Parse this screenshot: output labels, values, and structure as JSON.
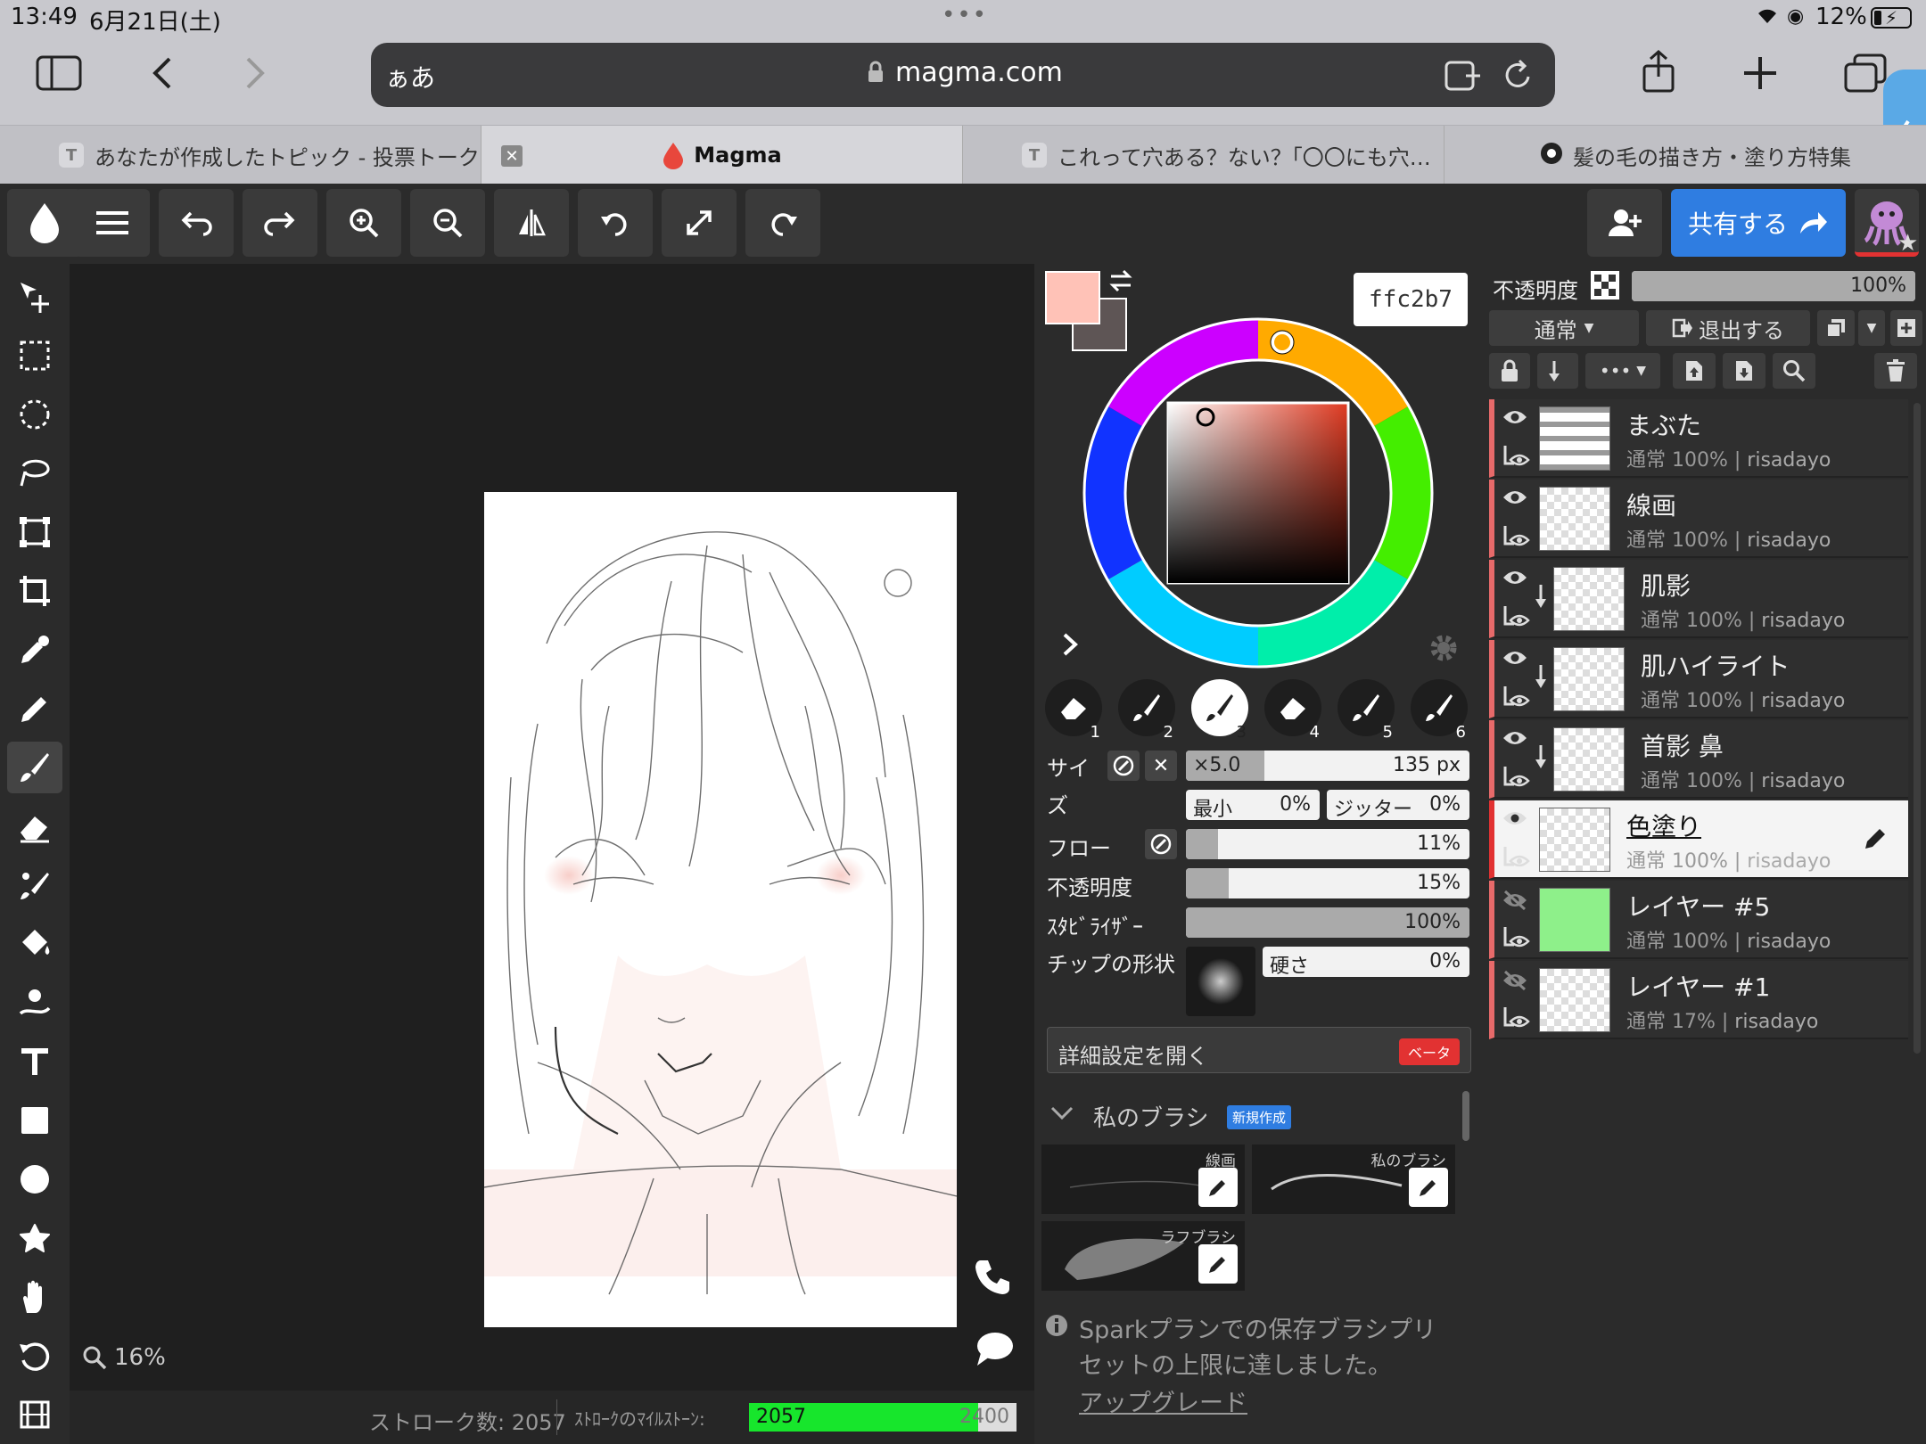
{
  "status_bar": {
    "time": "13:49",
    "date": "6月21日(土)",
    "battery": "12%"
  },
  "browser": {
    "url_left": "ぁあ",
    "url": "magma.com",
    "tabs": [
      {
        "label": "あなたが作成したトピック - 投票トーク",
        "favicon": "T"
      },
      {
        "label": "Magma",
        "active": true
      },
      {
        "label": "これって穴ある？ない？｢〇〇にも穴…",
        "favicon": "T"
      },
      {
        "label": "髪の毛の描き方・塗り方特集"
      }
    ]
  },
  "toolbar": {
    "share_label": "共有する"
  },
  "canvas": {
    "zoom": "16%"
  },
  "bottom_bar": {
    "stroke_count": "ストローク数: 2057",
    "milestone_label": "ｽﾄﾛｰｸのﾏｲﾙｽﾄｰﾝ:",
    "milestone_value": "2057",
    "milestone_target": "2400",
    "milestone_progress": 0.857
  },
  "color_panel": {
    "hex": "ffc2b7",
    "primary_color": "#ffc2b7",
    "secondary_color": "#5e5555"
  },
  "brush_panel": {
    "brush_numbers": [
      "1",
      "2",
      "3",
      "4",
      "5",
      "6"
    ],
    "size_label_1": "サイ",
    "size_label_2": "ズ",
    "size_multiplier": "×5.0",
    "size_value": "135 px",
    "min_label": "最小",
    "min_value": "0%",
    "jitter_label": "ジッター",
    "jitter_value": "0%",
    "flow_label": "フロー",
    "flow_value": "11%",
    "opacity_label": "不透明度",
    "opacity_value": "15%",
    "stabilizer_label": "ｽﾀﾋﾞﾗｲｻﾞｰ",
    "stabilizer_value": "100%",
    "tip_label": "チップの形状",
    "hardness_label": "硬さ",
    "hardness_value": "0%",
    "advanced_label": "詳細設定を開く",
    "beta_badge": "ベータ",
    "my_brushes_label": "私のブラシ",
    "new_badge": "新規作成",
    "presets": [
      "線画",
      "私のブラシ",
      "ラフブラシ"
    ],
    "notice": "Sparkプランでの保存ブラシプリセットの上限に達しました。",
    "notice_line1": "Sparkプランでの保存ブラシプリ",
    "notice_line2": "セットの上限に達しました。",
    "upgrade_link": "アップグレード"
  },
  "layers_panel": {
    "opacity_label": "不透明度",
    "opacity_value": "100%",
    "blend_mode": "通常",
    "exit_label": "退出する",
    "layers": [
      {
        "name": "まぶた",
        "meta": "通常 100% | ",
        "owner": "risadayo",
        "visible": true,
        "clipped": false
      },
      {
        "name": "線画",
        "meta": "通常 100% | ",
        "owner": "risadayo",
        "visible": true,
        "clipped": false
      },
      {
        "name": "肌影",
        "meta": "通常 100% | ",
        "owner": "risadayo",
        "visible": true,
        "clipped": true
      },
      {
        "name": "肌ハイライト",
        "meta": "通常 100% | ",
        "owner": "risadayo",
        "visible": true,
        "clipped": true
      },
      {
        "name": "首影 鼻",
        "meta": "通常 100% | ",
        "owner": "risadayo",
        "visible": true,
        "clipped": true
      },
      {
        "name": "色塗り",
        "meta": "通常 100% | ",
        "owner": "risadayo",
        "visible": true,
        "clipped": false,
        "selected": true
      },
      {
        "name": "レイヤー #5",
        "meta": "通常 100% | ",
        "owner": "risadayo",
        "visible": false,
        "clipped": false
      },
      {
        "name": "レイヤー #1",
        "meta": "通常 17% | ",
        "owner": "risadayo",
        "visible": false,
        "clipped": false
      }
    ]
  },
  "accent_color": "#2f7de1"
}
